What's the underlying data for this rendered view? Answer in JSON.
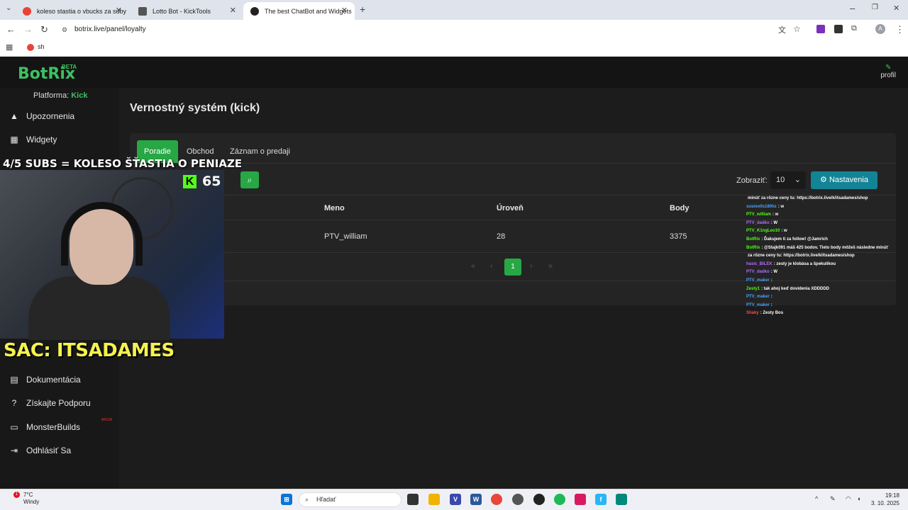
{
  "browser": {
    "tabs": [
      {
        "title": "koleso stastia o vbucks za suby",
        "close": "✕",
        "icon_color": "#ea4335"
      },
      {
        "title": "Lotto Bot - KickTools",
        "close": "✕",
        "icon_color": "#555555"
      },
      {
        "title": "The best ChatBot and Widgets",
        "close": "✕",
        "icon_color": "#222222"
      }
    ],
    "new_tab": "+",
    "url": "botrix.live/panel/loyalty",
    "bookmark": "sh"
  },
  "app": {
    "logo": "BotRix",
    "beta": "BETA",
    "profile": "profil",
    "platform_label": "Platforma:",
    "platform_value": "Kick",
    "accent": "#28a745"
  },
  "sidebar": {
    "items": [
      {
        "label": "Upozornenia",
        "icon": "warning-icon"
      },
      {
        "label": "Widgety",
        "icon": "grid-icon"
      },
      {
        "label": "Dokumentácia",
        "icon": "book-icon"
      },
      {
        "label": "Získajte Podporu",
        "icon": "help-icon"
      },
      {
        "label": "MonsterBuilds",
        "icon": "laptop-icon",
        "badge": "AKCIA"
      },
      {
        "label": "Odhlásiť Sa",
        "icon": "logout-icon"
      }
    ]
  },
  "main": {
    "title": "Vernostný systém (kick)",
    "tabs": [
      "Poradie",
      "Obchod",
      "Záznam o predaji"
    ],
    "show_label": "Zobraziť:",
    "show_value": "10",
    "settings_label": "Nastavenia",
    "table": {
      "headers": [
        "Meno",
        "Úroveň",
        "Body"
      ],
      "rows": [
        {
          "name": "PTV_william",
          "level": "28",
          "points": "3375"
        }
      ]
    },
    "pagination": {
      "first": "«",
      "prev": "‹",
      "current": "1",
      "next": "›",
      "last": "»"
    }
  },
  "stream_overlay": {
    "goal_text": "4/5 SUBS = KOLESO ŠŤASTIA O PENIAZE",
    "kick_count": "65",
    "sac_text": "SAC: ITSADAMES",
    "chat": [
      {
        "user": "",
        "msg": "minúť za rôzne ceny tu: https://botrix.live/k/itsadames/shop",
        "color": "#ffffff"
      },
      {
        "user": "susioo0s180hz",
        "msg": ": w",
        "color": "#4aa3ff"
      },
      {
        "user": "PTV_william",
        "msg": ": w",
        "color": "#53fc18"
      },
      {
        "user": "PTV_dadko",
        "msg": ": W",
        "color": "#b26cff"
      },
      {
        "user": "PTV_K1ngLeo10",
        "msg": ": w",
        "color": "#53fc18"
      },
      {
        "user": "BotRix",
        "msg": ": Ďakujem ti za follow! @Jamrich",
        "color": "#53fc18"
      },
      {
        "user": "BotRix",
        "msg": ": @Stajk091 máš 425 bodov. Tieto body môžeš následne minúť",
        "color": "#53fc18"
      },
      {
        "user": "",
        "msg": "za rôzne ceny tu: https://botrix.live/k/itsadames/shop",
        "color": "#ffffff"
      },
      {
        "user": "hasic_BILEK",
        "msg": ": zesty je klobása a špekulíkou",
        "color": "#b26cff"
      },
      {
        "user": "PTV_dadko",
        "msg": ": W",
        "color": "#b26cff"
      },
      {
        "user": "PTV_maker",
        "msg": ":",
        "color": "#4aa3ff"
      },
      {
        "user": "Zesty1",
        "msg": ": tak ahoj keď dovidenia XDDDDD",
        "color": "#53fc18"
      },
      {
        "user": "PTV_maker",
        "msg": ":",
        "color": "#4aa3ff"
      },
      {
        "user": "PTV_maker",
        "msg": ":",
        "color": "#4aa3ff"
      },
      {
        "user": "Shaky",
        "msg": ": Zesty Bos",
        "color": "#ff4a4a"
      }
    ]
  },
  "taskbar": {
    "weather_temp": "7°C",
    "weather_desc": "Windy",
    "notif_count": "1",
    "search_placeholder": "Hľadať",
    "time": "19:18",
    "date": "3. 10. 2025"
  }
}
